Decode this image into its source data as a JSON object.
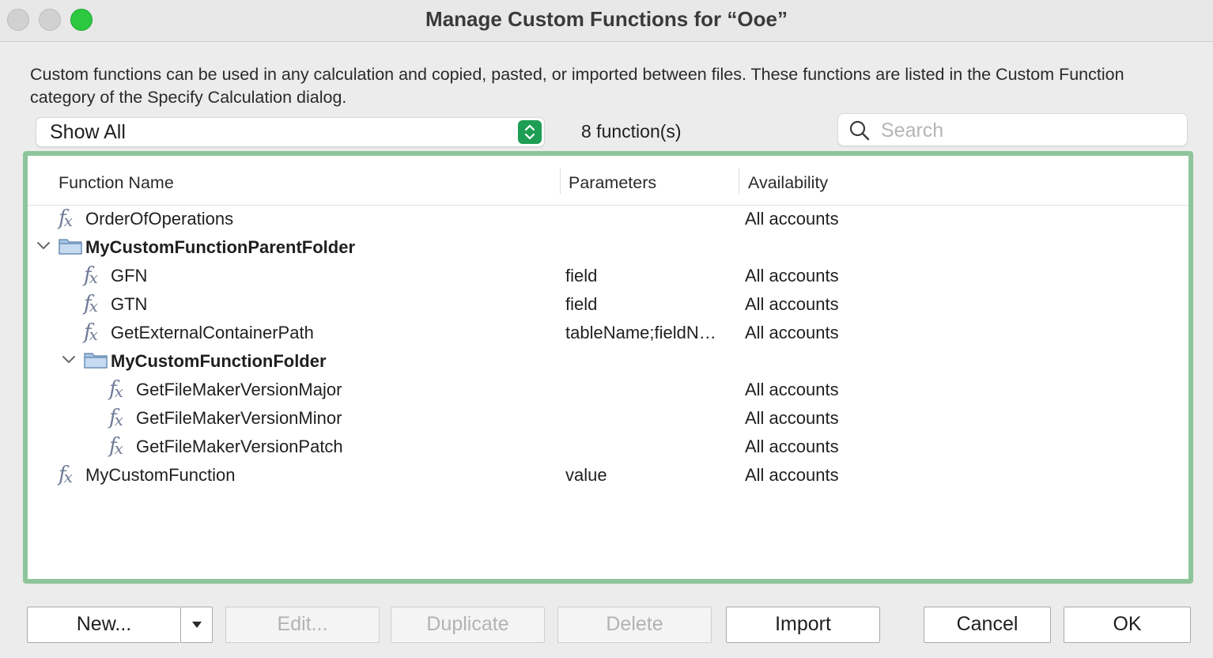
{
  "window": {
    "title": "Manage Custom Functions for “Ooe”"
  },
  "description": "Custom functions can be used in any calculation and copied, pasted, or imported between files. These functions are listed in the Custom Function category of the Specify Calculation dialog.",
  "filter": {
    "selected": "Show All"
  },
  "function_count": "8 function(s)",
  "search": {
    "placeholder": "Search",
    "value": ""
  },
  "columns": {
    "name": "Function Name",
    "parameters": "Parameters",
    "availability": "Availability"
  },
  "rows": [
    {
      "type": "function",
      "level": 0,
      "name": "OrderOfOperations",
      "parameters": "",
      "availability": "All accounts"
    },
    {
      "type": "folder",
      "level": 0,
      "name": "MyCustomFunctionParentFolder",
      "expanded": true
    },
    {
      "type": "function",
      "level": 1,
      "name": "GFN",
      "parameters": "field",
      "availability": "All accounts"
    },
    {
      "type": "function",
      "level": 1,
      "name": "GTN",
      "parameters": "field",
      "availability": "All accounts"
    },
    {
      "type": "function",
      "level": 1,
      "name": "GetExternalContainerPath",
      "parameters": "tableName;fieldN…",
      "availability": "All accounts"
    },
    {
      "type": "folder",
      "level": 1,
      "name": "MyCustomFunctionFolder",
      "expanded": true
    },
    {
      "type": "function",
      "level": 2,
      "name": "GetFileMakerVersionMajor",
      "parameters": "",
      "availability": "All accounts"
    },
    {
      "type": "function",
      "level": 2,
      "name": "GetFileMakerVersionMinor",
      "parameters": "",
      "availability": "All accounts"
    },
    {
      "type": "function",
      "level": 2,
      "name": "GetFileMakerVersionPatch",
      "parameters": "",
      "availability": "All accounts"
    },
    {
      "type": "function",
      "level": 0,
      "name": "MyCustomFunction",
      "parameters": "value",
      "availability": "All accounts"
    }
  ],
  "buttons": {
    "new": "New...",
    "edit": "Edit...",
    "duplicate": "Duplicate",
    "delete": "Delete",
    "import": "Import",
    "cancel": "Cancel",
    "ok": "OK"
  },
  "icons": {
    "function": "fx-icon",
    "folder": "folder-icon",
    "expand": "chevron-down-icon",
    "search": "search-icon"
  },
  "colors": {
    "focus_ring": "#8ec49a",
    "stepper": "#1e9e54",
    "zoom_button": "#2bc840"
  }
}
